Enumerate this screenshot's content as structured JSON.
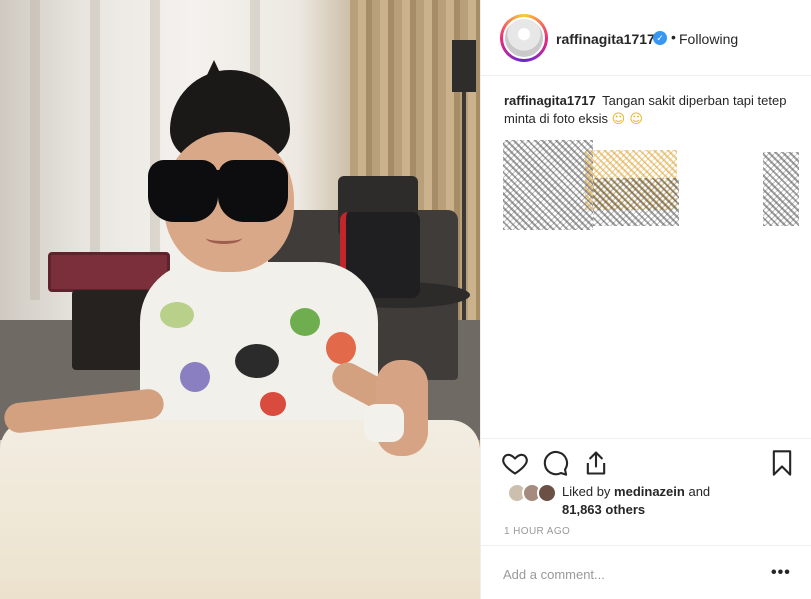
{
  "post": {
    "username": "raffinagita1717",
    "verified_badge": "✓",
    "separator": "•",
    "follow_status": "Following",
    "caption_user": "raffinagita1717",
    "caption_text": "Tangan sakit diperban tapi tetep minta di foto eksis",
    "caption_emojis": "☺ ☺",
    "likes_prefix": "Liked by",
    "likes_user": "medinazein",
    "likes_suffix": "and",
    "likes_count": "81,863 others",
    "timestamp": "1 HOUR AGO",
    "comment_placeholder": "Add a comment...",
    "more_glyph": "•••"
  },
  "icons": {
    "like": "heart-icon",
    "comment": "comment-bubble-icon",
    "share": "share-icon",
    "save": "bookmark-icon",
    "more": "more-options-icon"
  },
  "colors": {
    "verified": "#3897f0",
    "text": "#262626",
    "muted": "#999999",
    "border": "#efefef"
  }
}
